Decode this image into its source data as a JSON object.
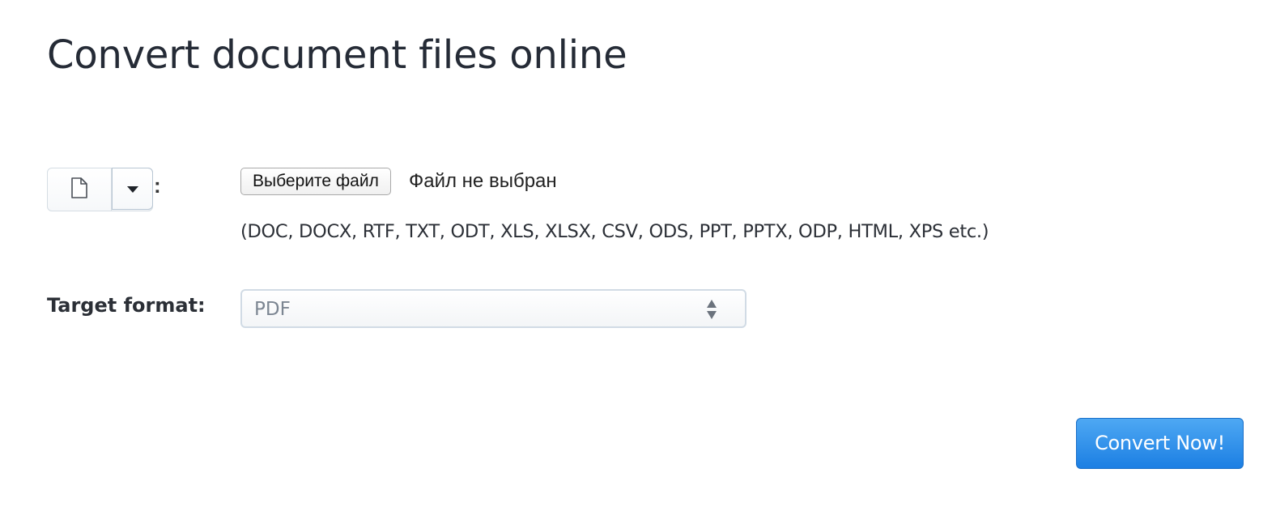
{
  "page": {
    "title": "Convert document files online"
  },
  "source": {
    "type_icon": "file-icon",
    "dropdown_icon": "caret-down-icon",
    "separator": ":"
  },
  "file_input": {
    "button_label": "Выберите файл",
    "status": "Файл не выбран",
    "supported_formats": "(DOC, DOCX, RTF, TXT, ODT, XLS, XLSX, CSV, ODS, PPT, PPTX, ODP, HTML, XPS etc.)"
  },
  "target": {
    "label": "Target format:",
    "selected": "PDF"
  },
  "actions": {
    "convert_label": "Convert Now!"
  },
  "colors": {
    "accent": "#1c7fe3",
    "title": "#252b36",
    "border": "#d1dbe5"
  }
}
